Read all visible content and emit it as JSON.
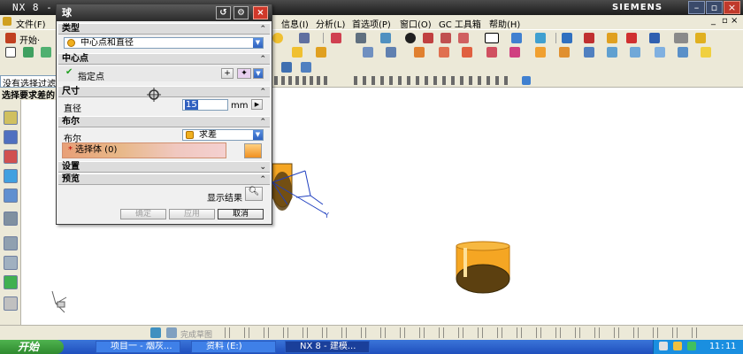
{
  "app": {
    "title": "NX 8 -",
    "brand": "SIEMENS",
    "title_extra": "]"
  },
  "menu": {
    "file": "文件(F)",
    "start": "开始·",
    "info": "信息(I)",
    "analysis": "分析(L)",
    "preferences": "首选项(P)",
    "window": "窗口(O)",
    "gc_toolbox": "GC 工具箱",
    "help": "帮助(H)"
  },
  "status": {
    "prompt_left": "没有选择过滤",
    "select_prompt": "选择要求差的"
  },
  "dialog": {
    "title": "球",
    "sections": {
      "type": "类型",
      "center": "中心点",
      "size": "尺寸",
      "boolean": "布尔",
      "settings": "设置",
      "preview": "预览"
    },
    "type_value": "中心点和直径",
    "specify_point": "指定点",
    "diameter_label": "直径",
    "diameter_value": "15",
    "diameter_unit": "mm",
    "boolean_label": "布尔",
    "boolean_value": "求差",
    "select_body": "选择体 (0)",
    "show_result": "显示结果",
    "buttons": {
      "ok": "确定",
      "apply": "应用",
      "cancel": "取消"
    }
  },
  "bottom_toolbar": {
    "finish_sketch": "完成草图"
  },
  "taskbar": {
    "start": "开始",
    "tasks": [
      "项目一 - 烟灰...",
      "资料 (E:)",
      "NX 8 - 建模..."
    ],
    "clock": "11:11"
  },
  "colors": {
    "cylinder": "#f5a623",
    "cylinder_dark": "#8a5a10",
    "dialog_title": "#2a2a2a",
    "taskbar": "#2558c8",
    "start_button": "#3a9a3a"
  }
}
